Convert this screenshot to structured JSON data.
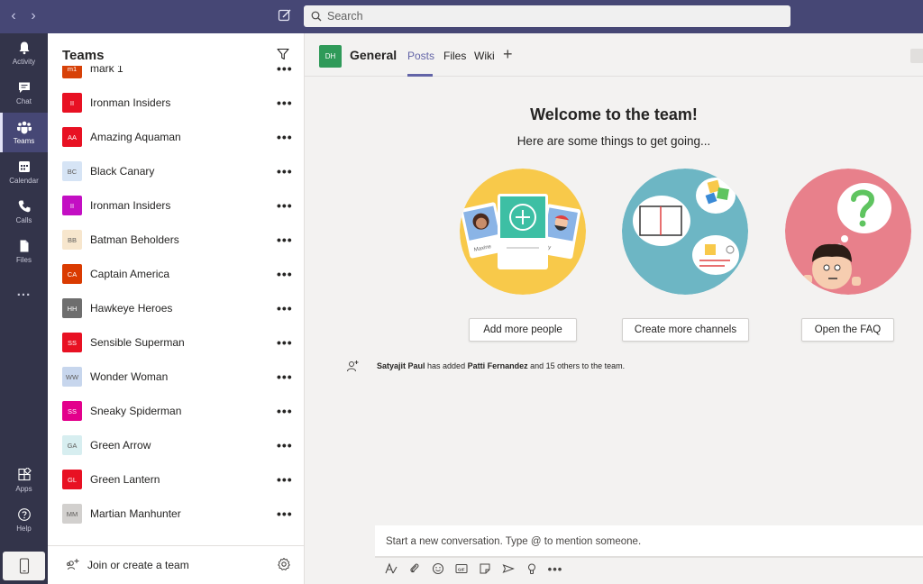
{
  "topbar": {
    "search_placeholder": "Search",
    "back": "‹",
    "forward": "›"
  },
  "rail": {
    "items": [
      {
        "label": "Activity"
      },
      {
        "label": "Chat"
      },
      {
        "label": "Teams"
      },
      {
        "label": "Calendar"
      },
      {
        "label": "Calls"
      },
      {
        "label": "Files"
      },
      {
        "label": "..."
      },
      {
        "label": "Apps"
      },
      {
        "label": "Help"
      }
    ]
  },
  "teams_panel": {
    "title": "Teams",
    "teams": [
      {
        "name": "mark 1",
        "initials": "m1",
        "color": "#d74108"
      },
      {
        "name": "Ironman Insiders",
        "initials": "II",
        "color": "#e81123"
      },
      {
        "name": "Amazing Aquaman",
        "initials": "AA",
        "color": "#e81123"
      },
      {
        "name": "Black Canary",
        "initials": "BC",
        "color": "#d6e4f5"
      },
      {
        "name": "Ironman Insiders",
        "initials": "II",
        "color": "#c30fc3"
      },
      {
        "name": "Batman Beholders",
        "initials": "BB",
        "color": "#f7e6cd"
      },
      {
        "name": "Captain America",
        "initials": "CA",
        "color": "#da3b01"
      },
      {
        "name": "Hawkeye Heroes",
        "initials": "HH",
        "color": "#6e6e6e"
      },
      {
        "name": "Sensible Superman",
        "initials": "SS",
        "color": "#e81123"
      },
      {
        "name": "Wonder Woman",
        "initials": "WW",
        "color": "#c7d6ed"
      },
      {
        "name": "Sneaky Spiderman",
        "initials": "SS",
        "color": "#e3008c"
      },
      {
        "name": "Green Arrow",
        "initials": "GA",
        "color": "#d7eef0"
      },
      {
        "name": "Green Lantern",
        "initials": "GL",
        "color": "#e81123"
      },
      {
        "name": "Martian Manhunter",
        "initials": "MM",
        "color": "#d2d0ce"
      }
    ],
    "more": "•••",
    "join_label": "Join or create a team"
  },
  "channel": {
    "avatar": "DH",
    "name": "General",
    "tabs": [
      "Posts",
      "Files",
      "Wiki"
    ],
    "add_tab": "+"
  },
  "welcome": {
    "title": "Welcome to the team!",
    "subtitle": "Here are some things to get going...",
    "buttons": [
      "Add more people",
      "Create more channels",
      "Open the FAQ"
    ],
    "card_names": [
      "Maxine",
      "ey"
    ]
  },
  "activity": {
    "actor": "Satyajit Paul",
    "middle": " has added ",
    "target": "Patti Fernandez",
    "tail": " and 15 others to the team."
  },
  "composer": {
    "placeholder": "Start a new conversation. Type @ to mention someone."
  },
  "colors": {
    "brand": "#6264a7",
    "rail": "#33344a",
    "topbar": "#464775"
  }
}
